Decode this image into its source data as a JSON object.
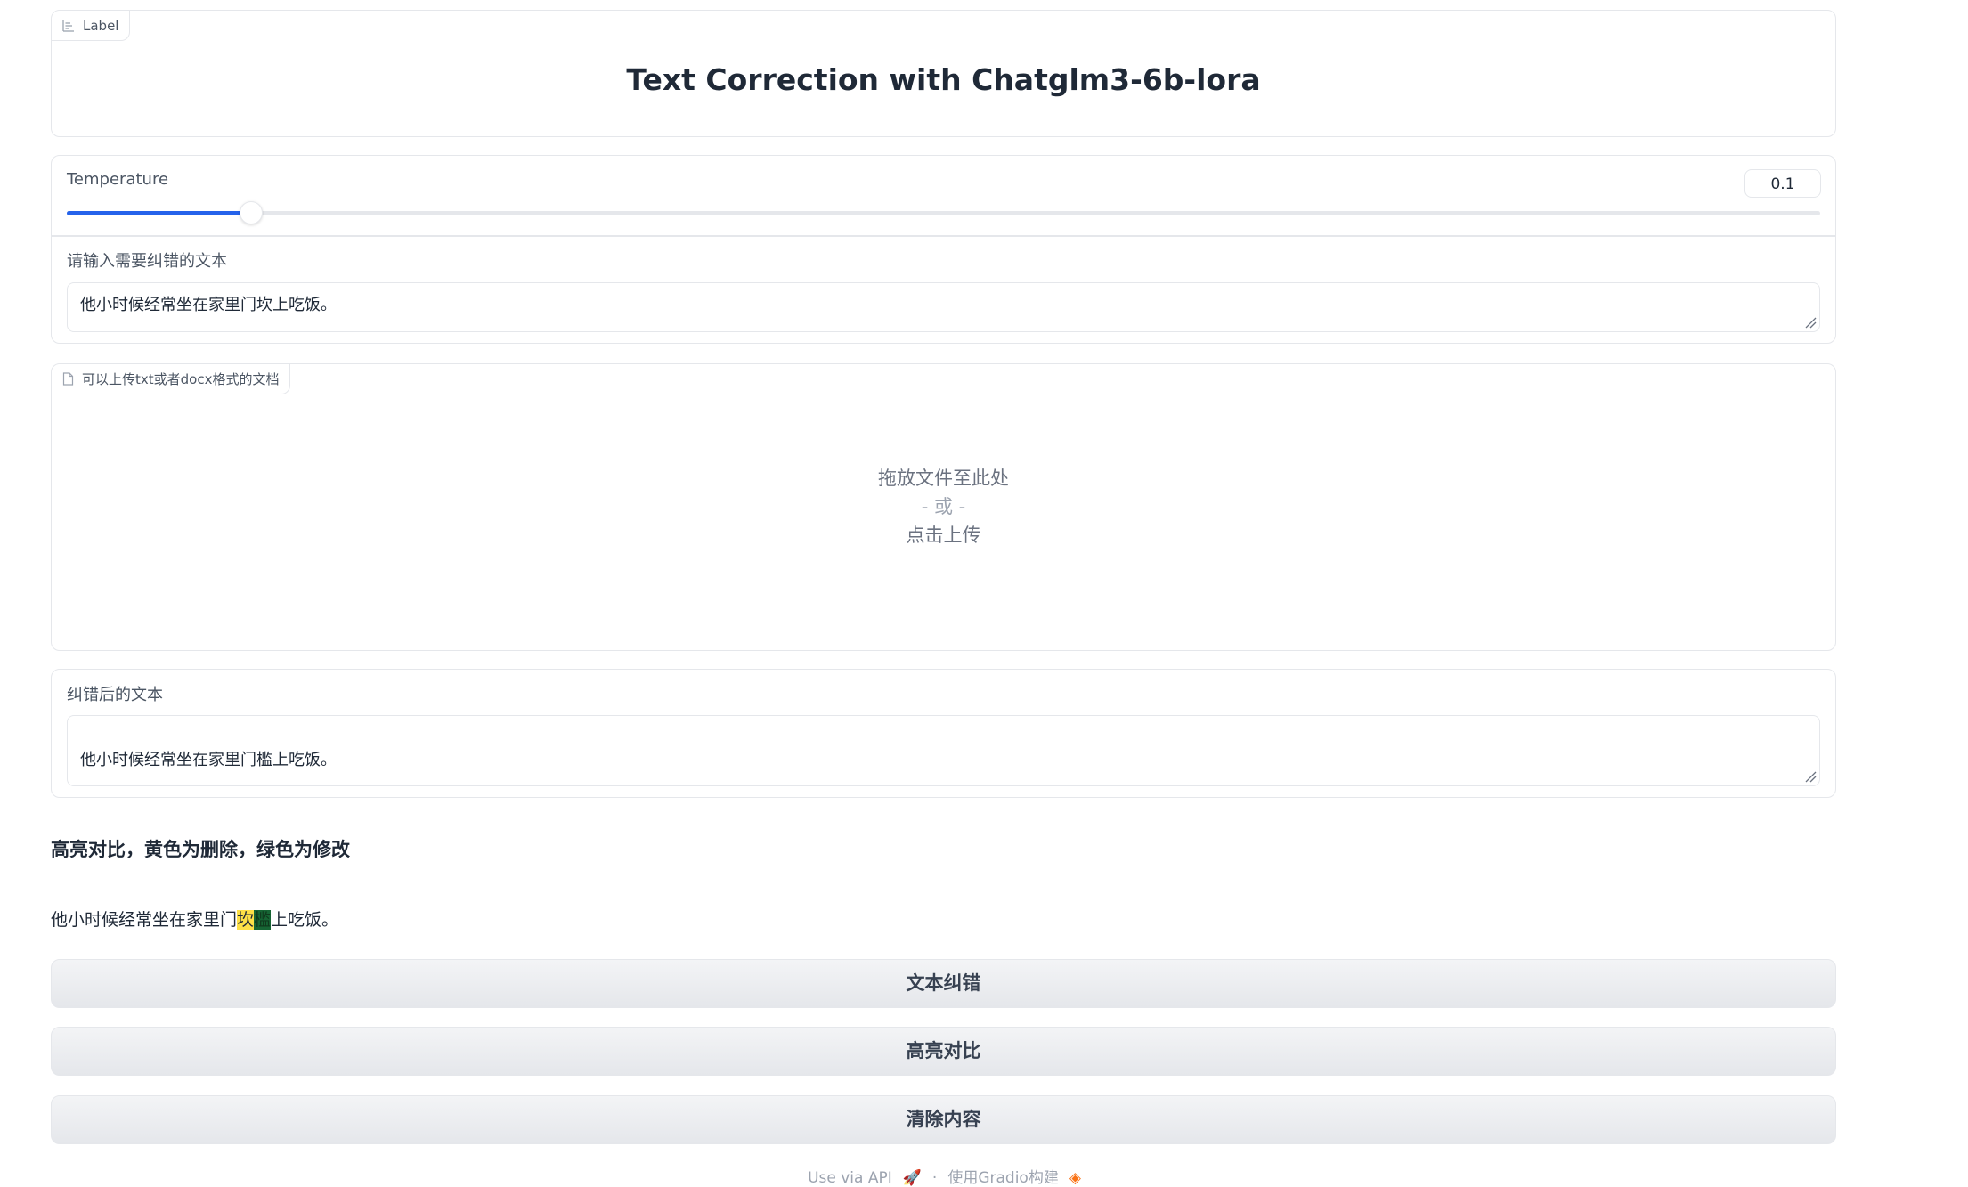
{
  "label_block": {
    "chip_label": "Label",
    "title": "Text Correction with Chatglm3-6b-lora"
  },
  "temperature": {
    "label": "Temperature",
    "value": "0.1",
    "fraction": 0.105
  },
  "input": {
    "label": "请输入需要纠错的文本",
    "value": "他小时候经常坐在家里门坎上吃饭。"
  },
  "upload": {
    "chip_label": "可以上传txt或者docx格式的文档",
    "drop_text": "拖放文件至此处",
    "or_text": "- 或 -",
    "click_text": "点击上传"
  },
  "output": {
    "label": "纠错后的文本",
    "value": "他小时候经常坐在家里门槛上吃饭。"
  },
  "highlight": {
    "title": "高亮对比，黄色为删除，绿色为修改",
    "prefix": "他小时候经常坐在家里门",
    "deleted": "坎",
    "modified": "槛",
    "suffix": "上吃饭。",
    "colors": {
      "deleted": "#fde047",
      "modified": "#166534"
    }
  },
  "buttons": {
    "correct": "文本纠错",
    "compare": "高亮对比",
    "clear": "清除内容"
  },
  "footer": {
    "api": "Use via API",
    "sep": "·",
    "built": "使用Gradio构建"
  },
  "icons": [
    "chart-icon",
    "file-icon",
    "rocket-icon",
    "gradio-logo-icon",
    "resize-handle-icon"
  ]
}
